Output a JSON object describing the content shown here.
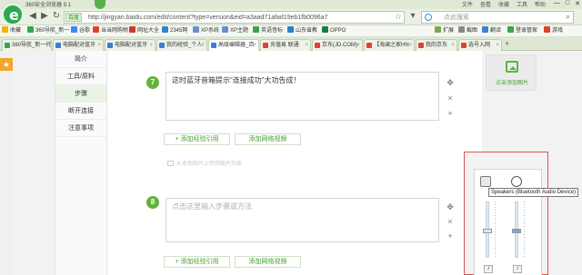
{
  "app": {
    "title": "360安全浏览器 9.1",
    "menu": [
      "文件",
      "查看",
      "收藏",
      "工具",
      "帮助"
    ],
    "controls": [
      "—",
      "□",
      "✕"
    ]
  },
  "nav": {
    "back": "◀",
    "forward": "▶",
    "refresh": "↻",
    "home": "⌂",
    "dropdown": "▾"
  },
  "address": {
    "badge": "百度",
    "url": "http://jingyan.baidu.com/edit/content?type=version&eid=a3aad71afad19eb1fb0096a7"
  },
  "search": {
    "placeholder": "点此搜索"
  },
  "bookmarks": {
    "items": [
      "收藏",
      "360导航_新一",
      "谷歌",
      "当当网购物",
      "网址大全",
      "2345网",
      "XP系统",
      "XP主题",
      "英语音标",
      "山东省教",
      "OPPO"
    ],
    "right": [
      "扩展",
      "截图",
      "翻译",
      "登录管家",
      "游戏"
    ]
  },
  "tabs": [
    {
      "label": "360导航_新一代"
    },
    {
      "label": "电脑配对蓝牙"
    },
    {
      "label": "电脑配对蓝牙"
    },
    {
      "label": "我的经验_个人"
    },
    {
      "label": "高级编辑器_百"
    },
    {
      "label": "充值易 联通"
    },
    {
      "label": "京东(JD.COM)"
    },
    {
      "label": "【海澜之家HN"
    },
    {
      "label": "我的京东"
    },
    {
      "label": "选号入网"
    }
  ],
  "sidenav": {
    "items": [
      "简介",
      "工具/原料",
      "步骤",
      "断开连接",
      "注意事项"
    ]
  },
  "steps": [
    {
      "number": "7",
      "text": "这时蓝牙音箱提示“连接成功”大功告成！"
    },
    {
      "number": "8",
      "placeholder": "点击这里输入步骤或方法"
    }
  ],
  "actions": {
    "add_experience": "+ 添加经验引用",
    "add_video": "添加网络视频"
  },
  "upload_hint": "从本地图片上传到图片列表",
  "icons": {
    "move": "✥",
    "close": "×",
    "add": "+"
  },
  "right_panel": {
    "add_image": "点击添加图片"
  },
  "mixer": {
    "tooltip": "Speakers (Bluetooth Audio Device)"
  },
  "colors": {
    "accent": "#62b33e",
    "chrome": "#eaf1e3",
    "mixer_border": "#d65454"
  }
}
